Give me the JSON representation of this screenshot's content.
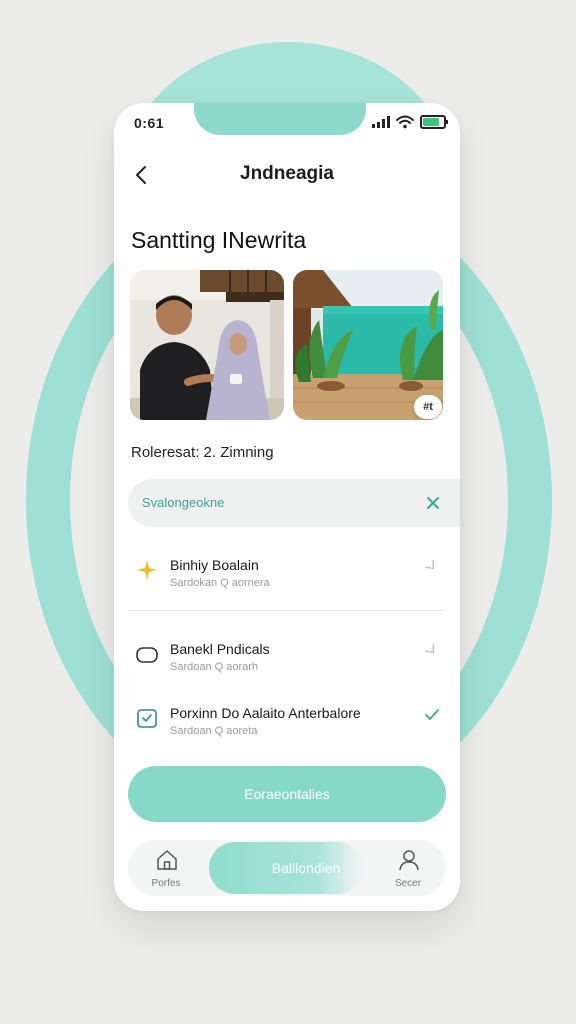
{
  "status": {
    "time": "0:61",
    "battery_level": 0.8
  },
  "header": {
    "title": "Jndneagia"
  },
  "page": {
    "title": "Santting INewrita"
  },
  "photos": {
    "badge": "#t"
  },
  "reference": {
    "text": "Roleresat: 2. Zimning"
  },
  "search": {
    "value": "Svalongeokne"
  },
  "list": {
    "items": [
      {
        "title": "Binhiy Boalain",
        "subtitle": "Sardokan  Q  aornera",
        "icon": "sparkle-icon"
      },
      {
        "title": "Banekl Pndicals",
        "subtitle": "Sardoan  Q  aorarh",
        "icon": "pill-icon"
      },
      {
        "title": "Porxinn Do Aalaito Anterbalore",
        "subtitle": "Sardoan  Q  aoreta",
        "icon": "checkbox-icon"
      }
    ]
  },
  "cta": {
    "label": "Eoraeontalies"
  },
  "tabbar": {
    "home_label": "Porfes",
    "active_label": "Balllondien",
    "profile_label": "Secer"
  },
  "colors": {
    "accent": "#86d8c8",
    "accent_text": "#3aa592",
    "star": "#f0bd2c"
  }
}
